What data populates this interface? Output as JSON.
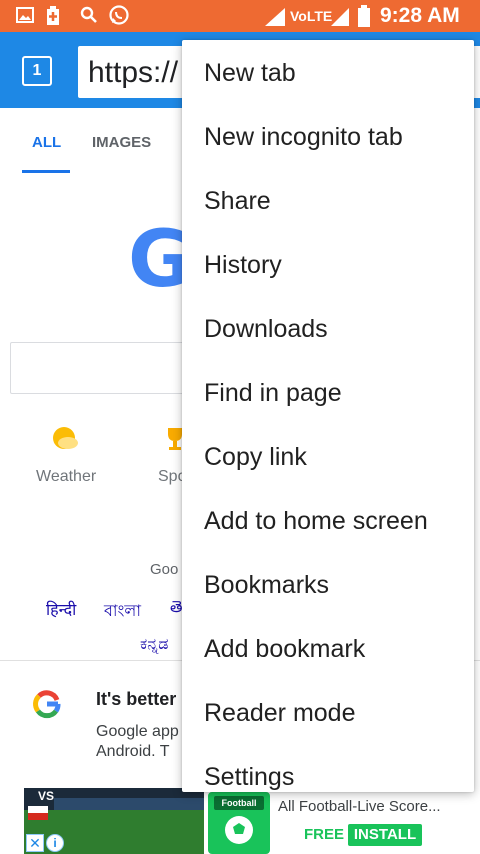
{
  "status_bar": {
    "network_label": "VoLTE",
    "time": "9:28 AM",
    "icons": [
      "gallery-icon",
      "battery-saver-icon",
      "search-icon",
      "whatsapp-icon",
      "signal-icon",
      "battery-icon"
    ]
  },
  "toolbar": {
    "tab_count": "1",
    "url": "https://"
  },
  "page": {
    "tabs": [
      "ALL",
      "IMAGES"
    ],
    "logo_letter": "G",
    "shortcuts": [
      {
        "label": "Weather",
        "icon": "weather-icon"
      },
      {
        "label": "Spo",
        "icon": "trophy-icon"
      }
    ],
    "offered_in": "Goo",
    "languages": [
      "हिन्दी",
      "বাংলা",
      "తె",
      "ಕನ್ನಡ"
    ],
    "promo": {
      "title": "It's better",
      "body_line1": "Google app",
      "body_line2": "Android. T"
    }
  },
  "ad": {
    "vs": "VS",
    "app_badge": "Football",
    "title": "All Football-Live Score...",
    "free": "FREE",
    "install": "INSTALL",
    "close_glyph": "✕",
    "info_glyph": "i"
  },
  "menu": {
    "items": [
      "New tab",
      "New incognito tab",
      "Share",
      "History",
      "Downloads",
      "Find in page",
      "Copy link",
      "Add to home screen",
      "Bookmarks",
      "Add bookmark",
      "Reader mode",
      "Settings"
    ]
  },
  "colors": {
    "status_bar": "#ee6a32",
    "toolbar": "#1e88e5",
    "accent": "#1a73e8",
    "install_green": "#19c35a"
  }
}
